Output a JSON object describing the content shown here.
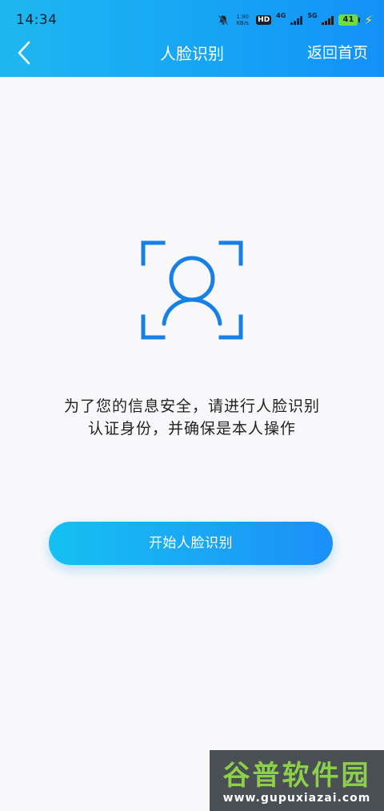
{
  "status_bar": {
    "time": "14:34",
    "net_speed_value": "1.90",
    "net_speed_unit": "KB/s",
    "hd_label": "HD",
    "net_4g": "4G",
    "net_5g": "5G",
    "battery": "41"
  },
  "header": {
    "title": "人脸识别",
    "home_label": "返回首页"
  },
  "main": {
    "line1": "为了您的信息安全，请进行人脸识别",
    "line2": "认证身份，并确保是本人操作",
    "button_label": "开始人脸识别"
  },
  "watermark": {
    "logo": "谷普软件园",
    "url": "www.gupuxiazai.com"
  },
  "colors": {
    "header_start": "#1fb7f0",
    "header_end": "#1391f8",
    "icon_blue": "#1680e8",
    "background": "#f8f8fa"
  },
  "icons": {
    "back": "chevron-left-icon",
    "face": "face-scan-icon"
  }
}
